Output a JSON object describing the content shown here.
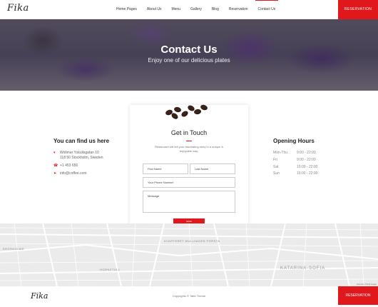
{
  "header": {
    "logo": "Fika",
    "nav": [
      {
        "label": "Home Pages",
        "active": false
      },
      {
        "label": "About Us",
        "active": false
      },
      {
        "label": "Menu",
        "active": false
      },
      {
        "label": "Gallery",
        "active": false
      },
      {
        "label": "Blog",
        "active": false
      },
      {
        "label": "Reservation",
        "active": false
      },
      {
        "label": "Contact Us",
        "active": true
      }
    ],
    "reserve_label": "RESERVATION"
  },
  "hero": {
    "title": "Contact Us",
    "subtitle": "Enjoy one of our delicious plates"
  },
  "find_us": {
    "title": "You can find us here",
    "address_line1": "Wollmar Yxkullsgatan 10",
    "address_line2": "118 50 Stockholm, Sweden",
    "phone": "+1 453 656",
    "email": "info@coffee.com"
  },
  "contact_form": {
    "title": "Get in Touch",
    "description": "Restaurant will tell your fascinating story in a unique & enjoyable way.",
    "first_name_placeholder": "First Name",
    "last_name_placeholder": "Last Name",
    "phone_placeholder": "Your Phone Number",
    "message_placeholder": "Message",
    "send_label": "SEND"
  },
  "hours": {
    "title": "Opening Hours",
    "rows": [
      {
        "day": "Mon-Thu",
        "time": "9:00 - 22:00"
      },
      {
        "day": "Fri",
        "time": "9:00 - 22:00"
      },
      {
        "day": "Sat",
        "time": "10:00 - 22:00"
      },
      {
        "day": "Sun",
        "time": "10:00 - 22:00"
      }
    ]
  },
  "map": {
    "labels": [
      "KVARTERET MULLVADEN FÖRSTA",
      "KATARINA-SOFIA",
      "HORNSTULL",
      "ERGSHOLME"
    ],
    "credit": "Data from ©2019 Google"
  },
  "footer": {
    "logo": "Fika",
    "copyright": "Copyrights © Tatte Theme",
    "reserve_label": "RESERVATION"
  },
  "colors": {
    "accent": "#e0171b"
  }
}
